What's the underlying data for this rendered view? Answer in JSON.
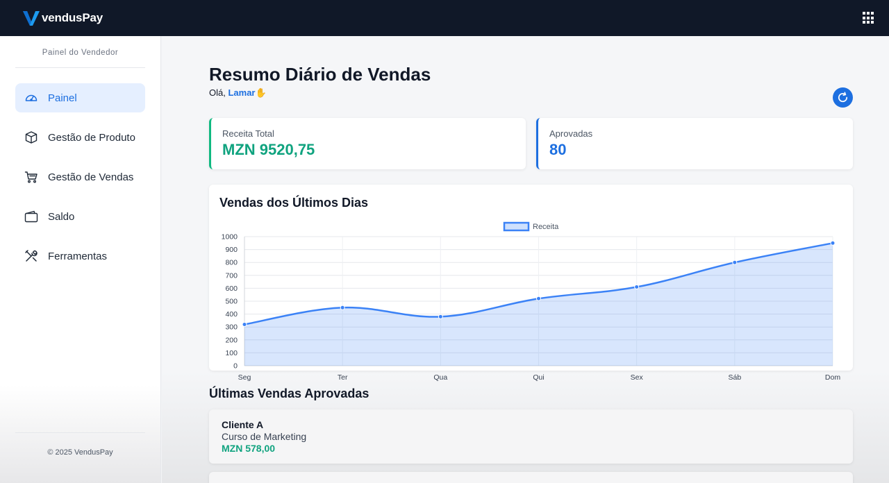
{
  "app": {
    "brand": "vendusPay",
    "brand_colors": {
      "dark": "#101828",
      "accent": "#1d6fe0",
      "success": "#10a37f"
    }
  },
  "sidebar": {
    "title": "Painel do Vendedor",
    "items": [
      {
        "label": "Painel",
        "icon": "dashboard-gauge-icon",
        "active": true
      },
      {
        "label": "Gestão de Produto",
        "icon": "box-icon",
        "active": false
      },
      {
        "label": "Gestão de Vendas",
        "icon": "cart-icon",
        "active": false
      },
      {
        "label": "Saldo",
        "icon": "wallet-icon",
        "active": false
      },
      {
        "label": "Ferramentas",
        "icon": "tools-icon",
        "active": false
      }
    ],
    "footer": "© 2025 VendusPay"
  },
  "header": {
    "title": "Resumo Diário de Vendas",
    "greeting_prefix": "Olá,",
    "user_name": "Lamar",
    "greeting_emoji": "✋"
  },
  "stats": {
    "revenue": {
      "label": "Receita Total",
      "value": "MZN 9520,75"
    },
    "approved": {
      "label": "Aprovadas",
      "value": "80"
    }
  },
  "chart_card": {
    "title": "Vendas dos Últimos Dias"
  },
  "chart_data": {
    "type": "area",
    "categories": [
      "Seg",
      "Ter",
      "Qua",
      "Qui",
      "Sex",
      "Sáb",
      "Dom"
    ],
    "series": [
      {
        "name": "Receita",
        "values": [
          320,
          450,
          380,
          520,
          610,
          800,
          950
        ],
        "color": "#3b82f6"
      }
    ],
    "yticks": [
      "0",
      "100",
      "200",
      "300",
      "400",
      "500",
      "600",
      "700",
      "800",
      "900",
      "1000"
    ],
    "ylim": [
      0,
      1000
    ],
    "grid": true,
    "legend": "top-center"
  },
  "recent_sales": {
    "title": "Últimas Vendas Aprovadas",
    "items": [
      {
        "client": "Cliente A",
        "product": "Curso de Marketing",
        "amount": "MZN 578,00"
      }
    ]
  }
}
